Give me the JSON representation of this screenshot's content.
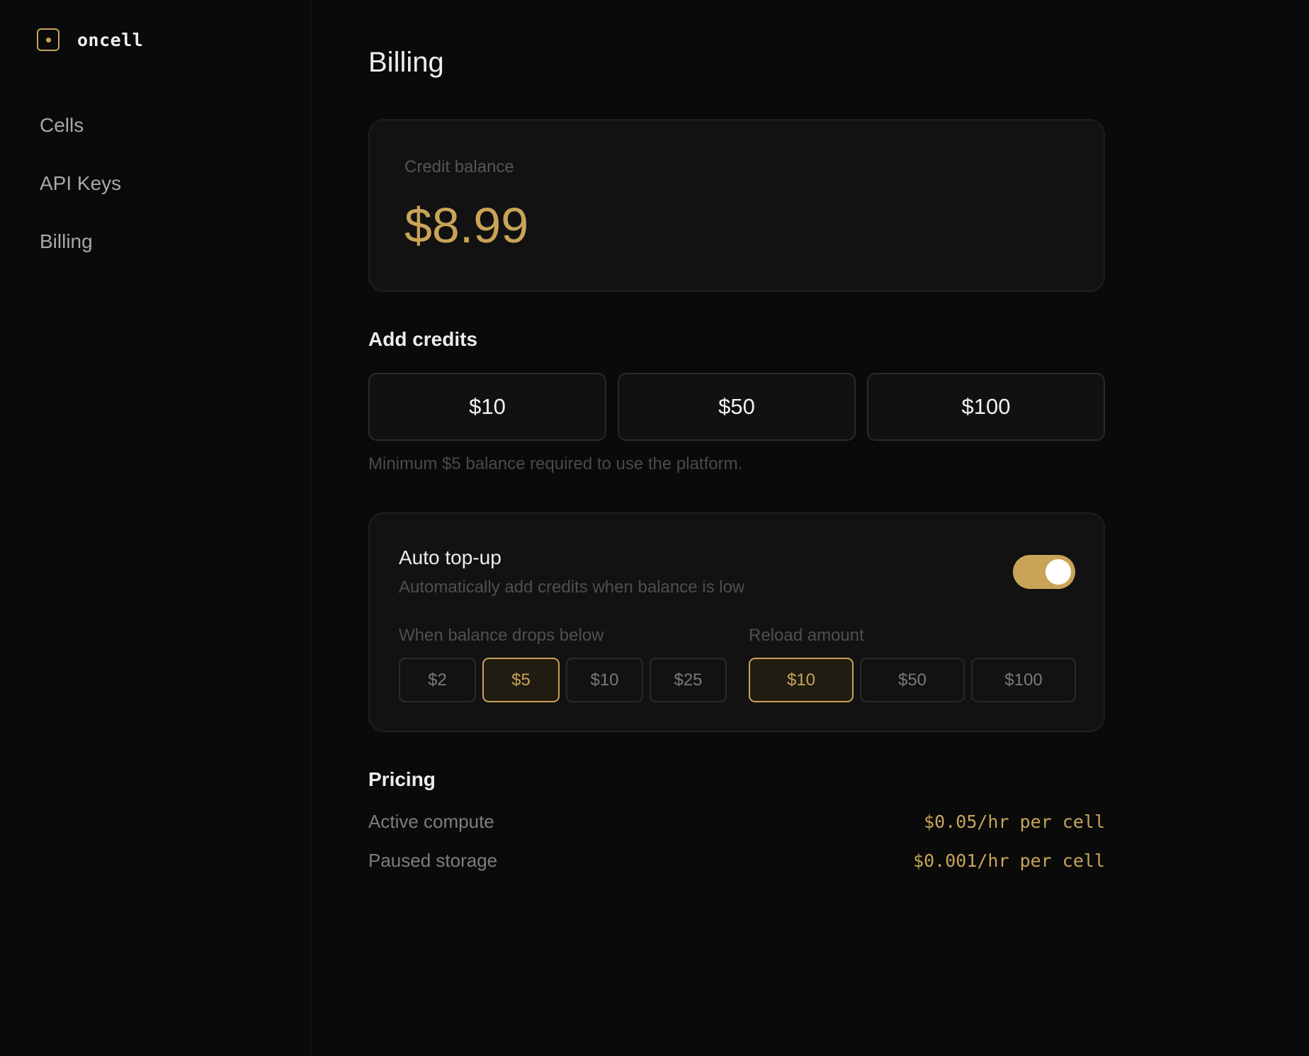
{
  "brand": {
    "name": "oncell",
    "icon": "square-dot-icon",
    "accent": "#c9a458"
  },
  "sidebar": {
    "items": [
      {
        "label": "Cells"
      },
      {
        "label": "API Keys"
      },
      {
        "label": "Billing"
      }
    ]
  },
  "page": {
    "title": "Billing"
  },
  "balance": {
    "label": "Credit balance",
    "value": "$8.99"
  },
  "add_credits": {
    "title": "Add credits",
    "options": [
      "$10",
      "$50",
      "$100"
    ],
    "note": "Minimum $5 balance required to use the platform."
  },
  "auto_topup": {
    "title": "Auto top-up",
    "description": "Automatically add credits when balance is low",
    "enabled": true,
    "threshold": {
      "label": "When balance drops below",
      "options": [
        "$2",
        "$5",
        "$10",
        "$25"
      ],
      "selected": "$5"
    },
    "reload": {
      "label": "Reload amount",
      "options": [
        "$10",
        "$50",
        "$100"
      ],
      "selected": "$10"
    }
  },
  "pricing": {
    "title": "Pricing",
    "rows": [
      {
        "label": "Active compute",
        "value": "$0.05/hr per cell"
      },
      {
        "label": "Paused storage",
        "value": "$0.001/hr per cell"
      }
    ]
  }
}
